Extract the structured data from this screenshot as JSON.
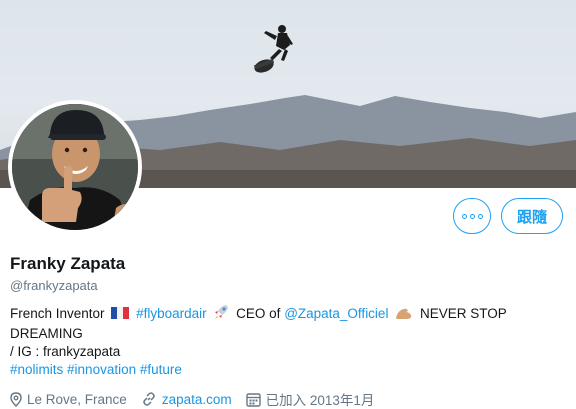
{
  "profile": {
    "name": "Franky Zapata",
    "handle": "@frankyzapata",
    "bio": {
      "line1_prefix": "French Inventor",
      "hashtag_flyboardair": "#flyboardair",
      "ceo_text": "CEO of",
      "mention": "@Zapata_Officiel",
      "never_stop": "NEVER STOP",
      "line2": "DREAMING",
      "line3": "/ IG : frankyzapata",
      "hashtags": [
        "#nolimits",
        "#innovation",
        "#future"
      ]
    },
    "location": "Le Rove, France",
    "website": "zapata.com",
    "joined": "已加入 2013年1月"
  },
  "actions": {
    "follow_label": "跟隨"
  },
  "icons": {
    "more": "more-icon",
    "location": "location-pin-icon",
    "website": "link-icon",
    "joined": "calendar-icon",
    "flag": "france-flag-icon",
    "rocket": "rocket-icon",
    "muscle": "flexed-biceps-icon"
  },
  "colors": {
    "accent": "#1da1f2",
    "link": "#1b95e0",
    "muted": "#657786"
  }
}
